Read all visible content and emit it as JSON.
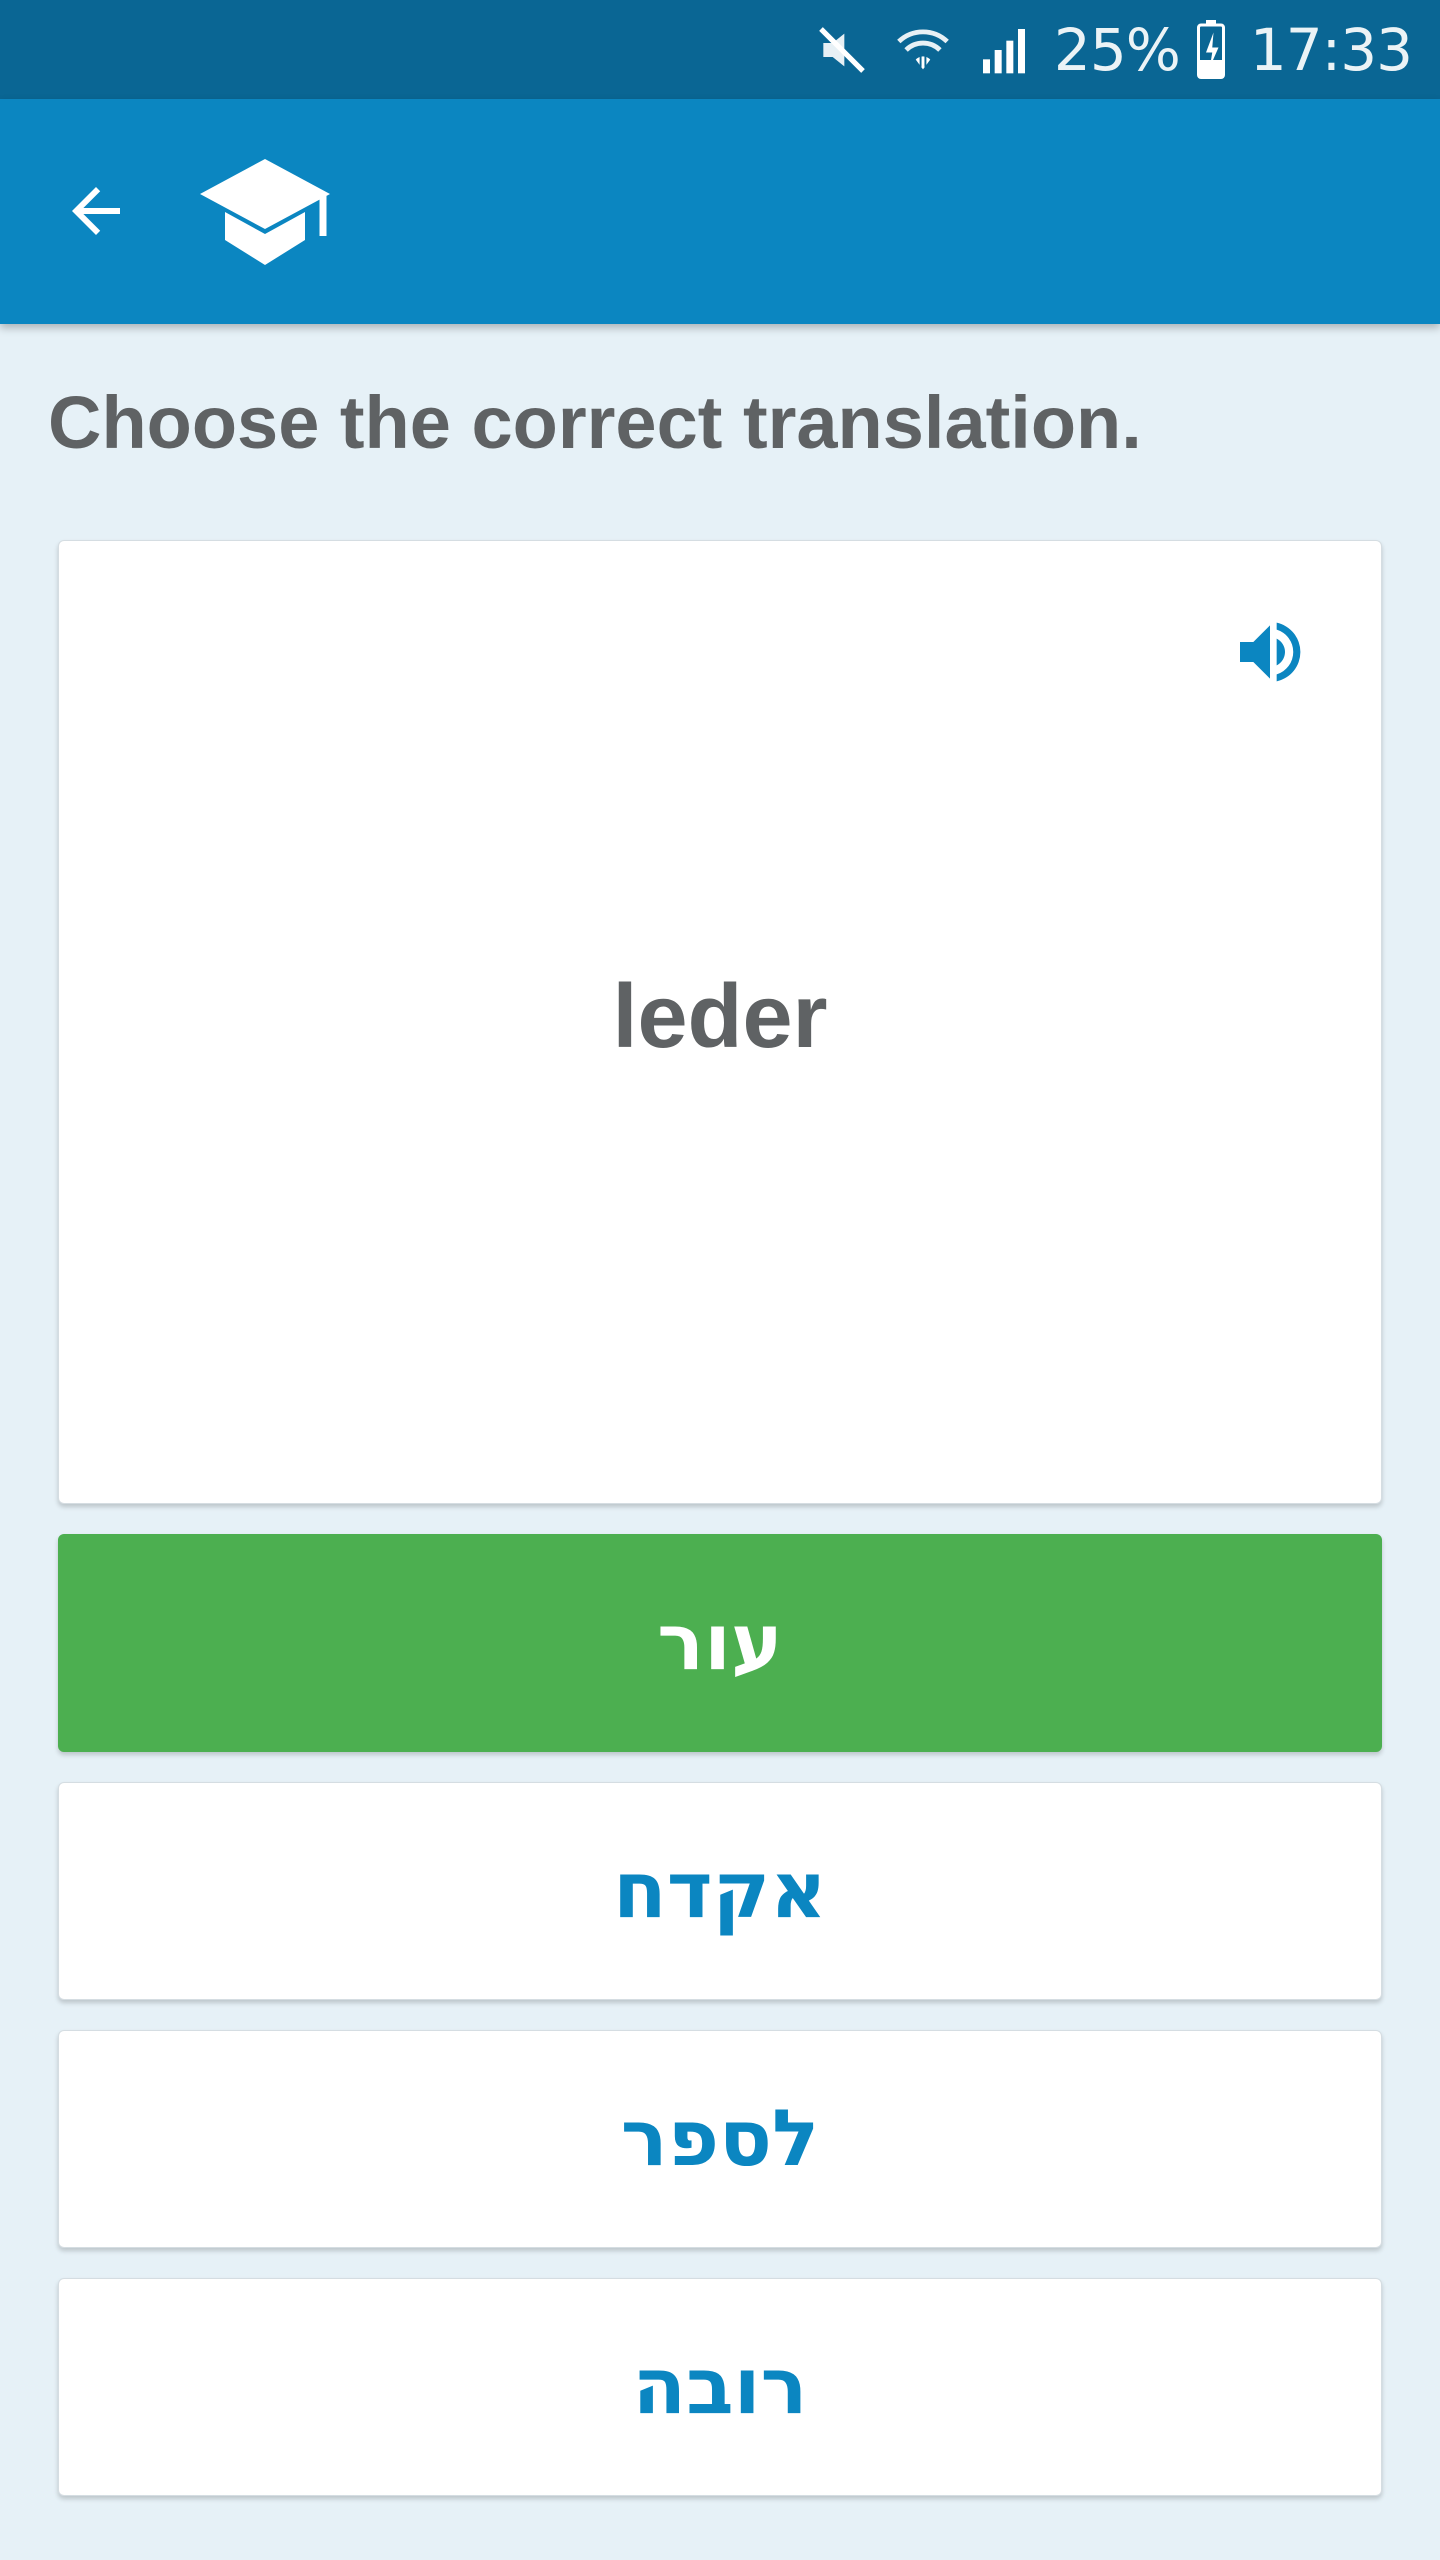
{
  "status_bar": {
    "battery_text": "25%",
    "time": "17:33"
  },
  "app_bar": {
    "back_icon": "arrow-left-icon",
    "logo_icon": "graduation-cap-icon"
  },
  "quiz": {
    "instruction": "Choose the correct translation.",
    "word": "leder",
    "speaker_icon": "speaker-icon",
    "answers": [
      {
        "label": "עור",
        "state": "correct"
      },
      {
        "label": "אקדח",
        "state": "default"
      },
      {
        "label": "לספר",
        "state": "default"
      },
      {
        "label": "רובה",
        "state": "default"
      }
    ]
  },
  "colors": {
    "status_bar": "#0a6694",
    "app_bar": "#0b86c1",
    "background": "#e6f1f7",
    "correct": "#4caf50",
    "answer_text": "#0b86c1",
    "text_gray": "#5f6264"
  }
}
